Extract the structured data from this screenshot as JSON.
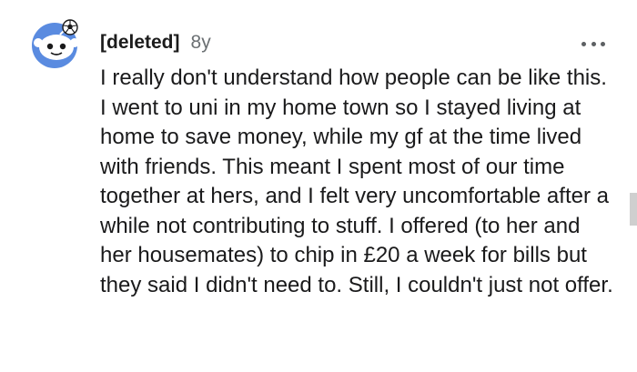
{
  "comment": {
    "username": "[deleted]",
    "age": "8y",
    "text": "I really don't understand how people can be like this. I went to uni in my home town so I stayed living at home to save money, while my gf at the time lived with friends. This meant I spent most of our time together at hers, and I felt very uncomfortable after a while not contributing to stuff. I offered (to her and her housemates) to chip in £20 a week for bills but they said I didn't need to. Still, I couldn't just not offer."
  },
  "icons": {
    "avatar": "snoo-avatar-icon",
    "more": "more-options-icon"
  },
  "colors": {
    "avatar_blue": "#5a8be0",
    "text": "#1a1a1b",
    "meta_gray": "#6b7073"
  }
}
